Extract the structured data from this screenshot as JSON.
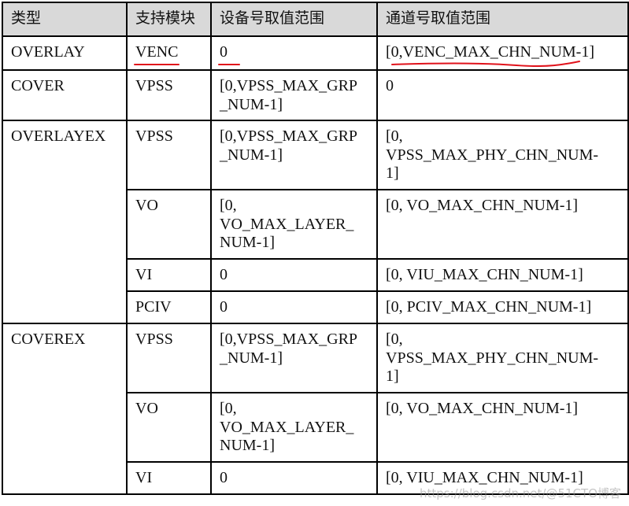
{
  "table": {
    "headers": [
      "类型",
      "支持模块",
      "设备号取值范围",
      "通道号取值范围"
    ],
    "rows": [
      {
        "type": "OVERLAY",
        "module": "VENC",
        "device_range": "0",
        "channel_range": "[0,VENC_MAX_CHN_NUM-1]"
      },
      {
        "type": "COVER",
        "module": "VPSS",
        "device_range": "[0,VPSS_MAX_GRP\n_NUM-1]",
        "channel_range": "0"
      },
      {
        "type": "OVERLAYEX",
        "module": "VPSS",
        "device_range": "[0,VPSS_MAX_GRP\n_NUM-1]",
        "channel_range": "[0,\nVPSS_MAX_PHY_CHN_NUM-\n1]"
      },
      {
        "type": "",
        "module": "VO",
        "device_range": "[0,\nVO_MAX_LAYER_\nNUM-1]",
        "channel_range": "[0, VO_MAX_CHN_NUM-1]"
      },
      {
        "type": "",
        "module": "VI",
        "device_range": "0",
        "channel_range": "[0, VIU_MAX_CHN_NUM-1]"
      },
      {
        "type": "",
        "module": "PCIV",
        "device_range": "0",
        "channel_range": "[0, PCIV_MAX_CHN_NUM-1]"
      },
      {
        "type": "COVEREX",
        "module": "VPSS",
        "device_range": "[0,VPSS_MAX_GRP\n_NUM-1]",
        "channel_range": "[0,\nVPSS_MAX_PHY_CHN_NUM-\n1]"
      },
      {
        "type": "",
        "module": "VO",
        "device_range": "[0,\nVO_MAX_LAYER_\nNUM-1]",
        "channel_range": "[0, VO_MAX_CHN_NUM-1]"
      },
      {
        "type": "",
        "module": "VI",
        "device_range": "0",
        "channel_range": "[0, VIU_MAX_CHN_NUM-1]"
      }
    ]
  },
  "annotations": {
    "underline_color": "#e0121b",
    "underlined_cells": [
      "row0.module",
      "row0.device_range",
      "row0.channel_range"
    ]
  },
  "colors": {
    "header_bg": "#d9d9d9",
    "border": "#000000",
    "text": "#111111"
  },
  "watermark": "https://blog.csdn.net/@51CTO博客"
}
